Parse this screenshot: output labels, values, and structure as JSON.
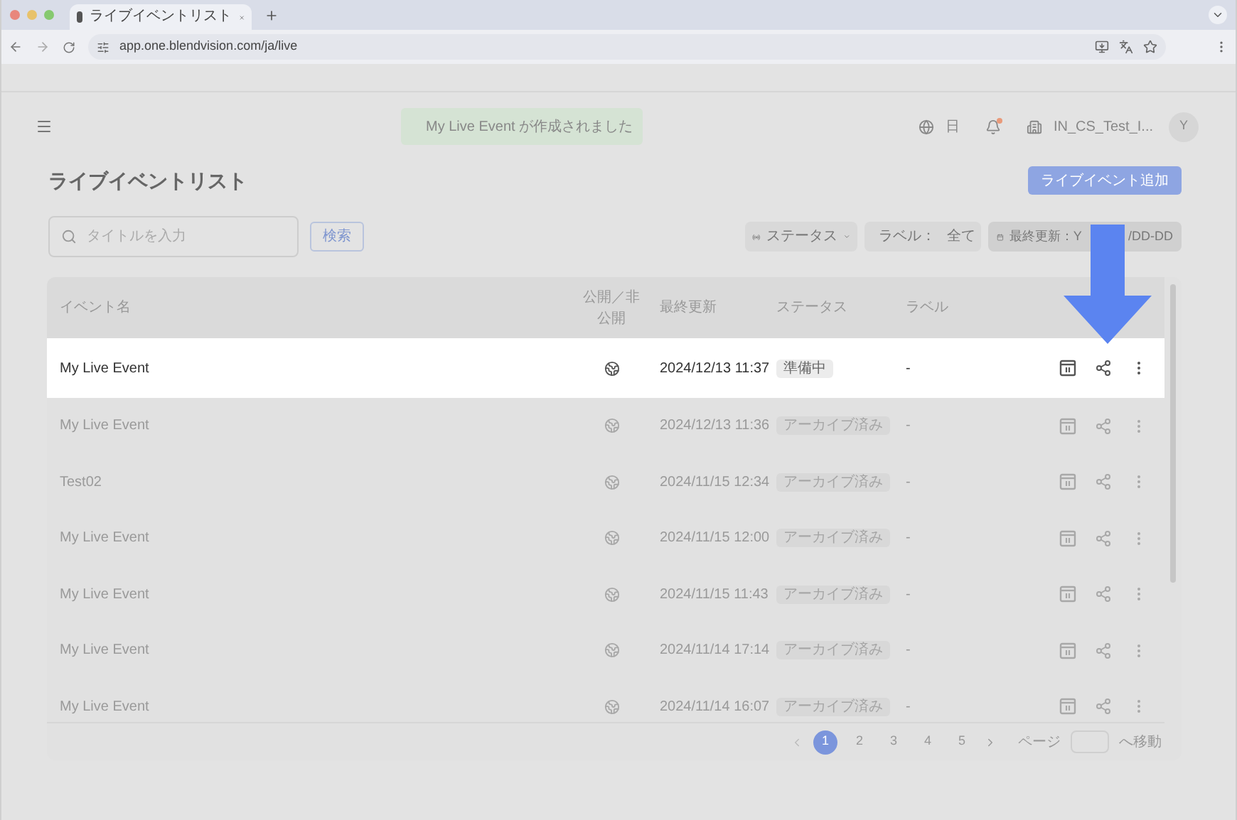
{
  "browser": {
    "tab_title": "ライブイベントリスト",
    "url": "app.one.blendvision.com/ja/live"
  },
  "header": {
    "toast": "My Live Event が作成されました",
    "language": "日",
    "notification_dot": true,
    "organization": "IN_CS_Test_I...",
    "avatar": "Y"
  },
  "page": {
    "title": "ライブイベントリスト",
    "add_button": "ライブイベント追加"
  },
  "search": {
    "placeholder": "タイトルを入力",
    "button": "検索"
  },
  "filters": {
    "status": "ステータス",
    "label": "ラベル：",
    "label_value": "全て",
    "date_visible_start": "最終更新：Y",
    "date_visible_end": "/DD-DD"
  },
  "table": {
    "columns": [
      "イベント名",
      "公開／非公開",
      "最終更新",
      "ステータス",
      "ラベル"
    ],
    "rows": [
      {
        "name": "My Live Event",
        "updated": "2024/12/13 11:37",
        "status": "準備中",
        "label": "-",
        "highlighted": true
      },
      {
        "name": "My Live Event",
        "updated": "2024/12/13 11:36",
        "status": "アーカイブ済み",
        "label": "-",
        "highlighted": false
      },
      {
        "name": "Test02",
        "updated": "2024/11/15 12:34",
        "status": "アーカイブ済み",
        "label": "-",
        "highlighted": false
      },
      {
        "name": "My Live Event",
        "updated": "2024/11/15 12:00",
        "status": "アーカイブ済み",
        "label": "-",
        "highlighted": false
      },
      {
        "name": "My Live Event",
        "updated": "2024/11/15 11:43",
        "status": "アーカイブ済み",
        "label": "-",
        "highlighted": false
      },
      {
        "name": "My Live Event",
        "updated": "2024/11/14 17:14",
        "status": "アーカイブ済み",
        "label": "-",
        "highlighted": false
      },
      {
        "name": "My Live Event",
        "updated": "2024/11/14 16:07",
        "status": "アーカイブ済み",
        "label": "-",
        "highlighted": false
      }
    ]
  },
  "pagination": {
    "pages": [
      {
        "label": "1",
        "selected": true
      },
      {
        "label": "2",
        "selected": false
      },
      {
        "label": "3",
        "selected": false
      },
      {
        "label": "4",
        "selected": false
      },
      {
        "label": "5",
        "selected": false
      }
    ],
    "page_label": "ページ",
    "go_label": "へ移動"
  }
}
